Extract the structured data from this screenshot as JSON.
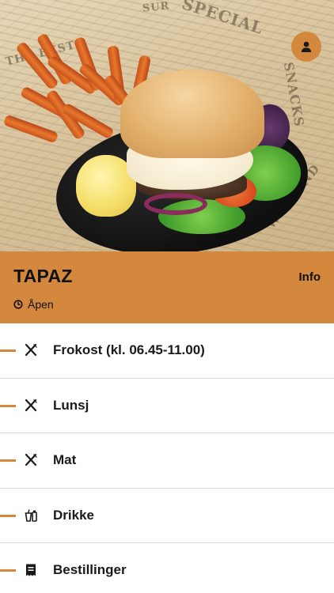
{
  "venue": {
    "name": "TAPAZ",
    "info_label": "Info",
    "status": "Åpen",
    "accent_color": "#d4883e"
  },
  "hero": {
    "newspaper_text": [
      "SPECIAL",
      "THE BEST",
      "SNACKS",
      "SALT WEEKEND",
      "SUR"
    ]
  },
  "icons": {
    "profile": "person-icon",
    "status": "clock-icon",
    "food": "fork-knife-icon",
    "drinks": "drink-icon",
    "orders": "receipt-icon"
  },
  "menu": {
    "items": [
      {
        "label": "Frokost (kl. 06.45-11.00)",
        "icon": "fork-knife-icon"
      },
      {
        "label": "Lunsj",
        "icon": "fork-knife-icon"
      },
      {
        "label": "Mat",
        "icon": "fork-knife-icon"
      },
      {
        "label": "Drikke",
        "icon": "drink-icon"
      },
      {
        "label": "Bestillinger",
        "icon": "receipt-icon"
      }
    ]
  }
}
